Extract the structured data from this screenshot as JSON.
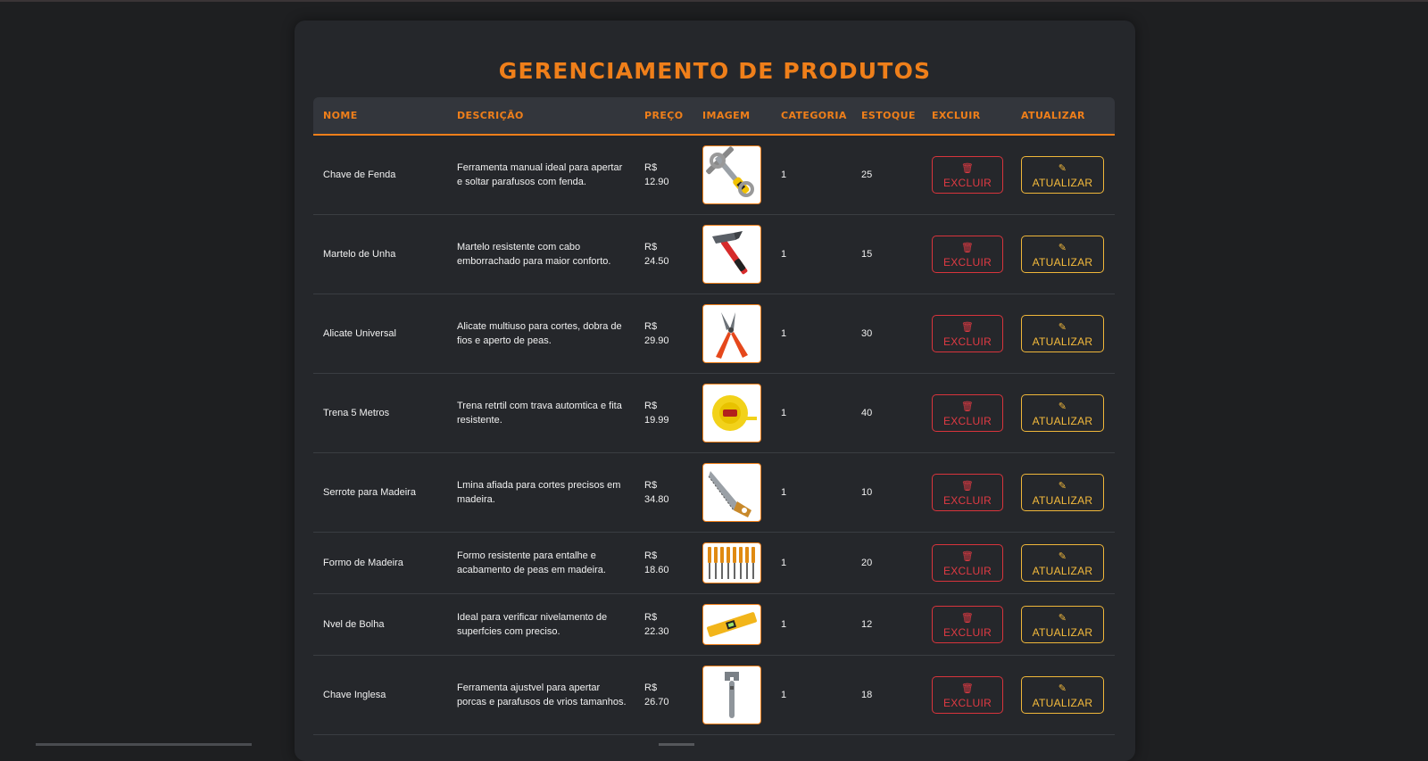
{
  "page": {
    "title": "GERENCIAMENTO DE PRODUTOS"
  },
  "table": {
    "headers": {
      "nome": "NOME",
      "descricao": "DESCRIÇÃO",
      "preco": "PREÇO",
      "imagem": "IMAGEM",
      "categoria": "CATEGORIA",
      "estoque": "ESTOQUE",
      "excluir": "EXCLUIR",
      "atualizar": "ATUALIZAR"
    },
    "rows": [
      {
        "nome": "Chave de Fenda",
        "descricao": "Ferramenta manual ideal para apertar e soltar parafusos com fenda.",
        "preco_label": "R$",
        "preco": "12.90",
        "categoria": "1",
        "estoque": "25",
        "image_icon": "screwdriver-wrench-image"
      },
      {
        "nome": "Martelo de Unha",
        "descricao": "Martelo resistente com cabo emborrachado para maior conforto.",
        "preco_label": "R$",
        "preco": "24.50",
        "categoria": "1",
        "estoque": "15",
        "image_icon": "hammer-image"
      },
      {
        "nome": "Alicate Universal",
        "descricao": "Alicate multiuso para cortes, dobra de fios e aperto de peas.",
        "preco_label": "R$",
        "preco": "29.90",
        "categoria": "1",
        "estoque": "30",
        "image_icon": "pliers-image"
      },
      {
        "nome": "Trena 5 Metros",
        "descricao": "Trena retrtil com trava automtica e fita resistente.",
        "preco_label": "R$",
        "preco": "19.99",
        "categoria": "1",
        "estoque": "40",
        "image_icon": "tape-measure-image"
      },
      {
        "nome": "Serrote para Madeira",
        "descricao": "Lmina afiada para cortes precisos em madeira.",
        "preco_label": "R$",
        "preco": "34.80",
        "categoria": "1",
        "estoque": "10",
        "image_icon": "handsaw-image"
      },
      {
        "nome": "Formo de Madeira",
        "descricao": "Formo resistente para entalhe e acabamento de peas em madeira.",
        "preco_label": "R$",
        "preco": "18.60",
        "categoria": "1",
        "estoque": "20",
        "image_icon": "chisel-set-image"
      },
      {
        "nome": "Nvel de Bolha",
        "descricao": "Ideal para verificar nivelamento de superfcies com preciso.",
        "preco_label": "R$",
        "preco": "22.30",
        "categoria": "1",
        "estoque": "12",
        "image_icon": "spirit-level-image"
      },
      {
        "nome": "Chave Inglesa",
        "descricao": "Ferramenta ajustvel para apertar porcas e parafusos de vrios tamanhos.",
        "preco_label": "R$",
        "preco": "26.70",
        "categoria": "1",
        "estoque": "18",
        "image_icon": "adjustable-wrench-image"
      }
    ]
  },
  "buttons": {
    "excluir": {
      "label": "EXCLUIR",
      "icon": "trash-icon",
      "color": "#e03a43"
    },
    "atualizar": {
      "label": "ATUALIZAR",
      "icon": "edit-icon",
      "color": "#f5bb3c"
    }
  },
  "colors": {
    "accent": "#ef7f1a",
    "background": "#1e1f21",
    "panel": "#25272b"
  }
}
